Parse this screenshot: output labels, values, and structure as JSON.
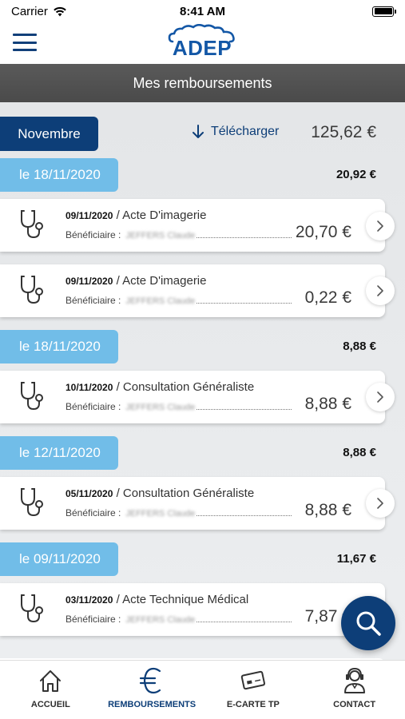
{
  "status_bar": {
    "carrier": "Carrier",
    "time": "8:41 AM"
  },
  "brand": {
    "logo_text": "ADEP"
  },
  "page": {
    "title": "Mes remboursements"
  },
  "month": {
    "label": "Novembre",
    "download_label": "Télécharger",
    "total": "125,62 €"
  },
  "groups": [
    {
      "date_label": "le 18/11/2020",
      "total": "20,92 €",
      "items": [
        {
          "date": "09/11/2020",
          "act": " / Acte D'imagerie",
          "beneficiary_label": "Bénéficiaire :",
          "beneficiary_name": "JEFFERS Claude",
          "amount": "20,70 €"
        },
        {
          "date": "09/11/2020",
          "act": " / Acte D'imagerie",
          "beneficiary_label": "Bénéficiaire :",
          "beneficiary_name": "JEFFERS Claude",
          "amount": "0,22 €"
        }
      ]
    },
    {
      "date_label": "le 18/11/2020",
      "total": "8,88 €",
      "items": [
        {
          "date": "10/11/2020",
          "act": " / Consultation Généraliste",
          "beneficiary_label": "Bénéficiaire :",
          "beneficiary_name": "JEFFERS Claude",
          "amount": "8,88 €"
        }
      ]
    },
    {
      "date_label": "le 12/11/2020",
      "total": "8,88 €",
      "items": [
        {
          "date": "05/11/2020",
          "act": " / Consultation Généraliste",
          "beneficiary_label": "Bénéficiaire :",
          "beneficiary_name": "JEFFERS Claude",
          "amount": "8,88 €"
        }
      ]
    },
    {
      "date_label": "le 09/11/2020",
      "total": "11,67 €",
      "items": [
        {
          "date": "03/11/2020",
          "act": " / Acte Technique Médical",
          "beneficiary_label": "Bénéficiaire :",
          "beneficiary_name": "JEFFERS Claude",
          "amount": "7,87 €"
        }
      ]
    }
  ],
  "tabs": [
    {
      "label": "ACCUEIL",
      "icon": "home-icon"
    },
    {
      "label": "REMBOURSEMENTS",
      "icon": "euro-icon",
      "active": true
    },
    {
      "label": "E-CARTE TP",
      "icon": "card-icon"
    },
    {
      "label": "CONTACT",
      "icon": "support-agent-icon"
    }
  ],
  "colors": {
    "primary": "#0d3e78",
    "date_tab": "#71bde8",
    "title_bar": "#4f4f4f",
    "logo": "#1357a6"
  }
}
